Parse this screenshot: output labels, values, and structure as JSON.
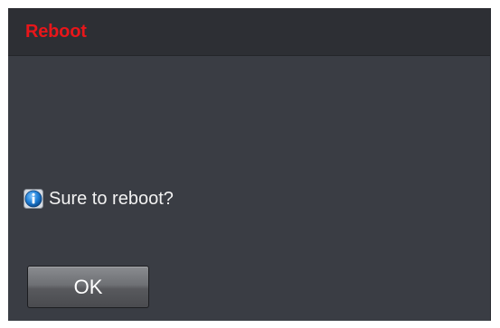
{
  "dialog": {
    "title": "Reboot",
    "title_color": "#e8161a",
    "background": "#3a3d44",
    "header_background": "#2d2f34",
    "message": {
      "icon": "info-icon",
      "text": "Sure to reboot?"
    },
    "ok_label": "OK"
  }
}
